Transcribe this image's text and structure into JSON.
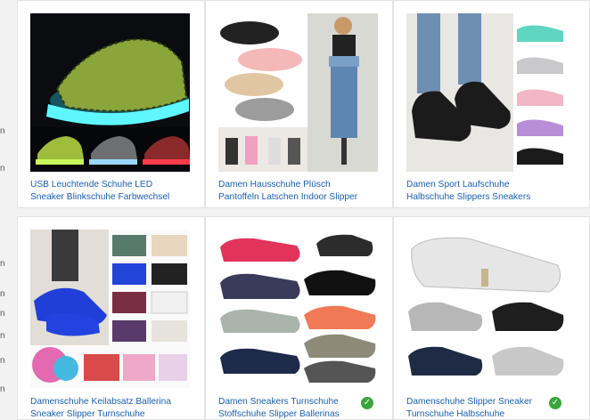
{
  "products": [
    {
      "line1": "USB Leuchtende Schuhe LED",
      "line2": "Sneaker Blinkschuhe Farbwechsel",
      "icon": "led-sneaker-image",
      "verified": false
    },
    {
      "line1": "Damen Hausschuhe Plüsch",
      "line2": "Pantoffeln Latschen Indoor Slipper",
      "icon": "slipper-image",
      "verified": false
    },
    {
      "line1": "Damen Sport Laufschuhe",
      "line2": "Halbschuhe Slippers Sneakers",
      "icon": "sock-sneaker-image",
      "verified": false
    },
    {
      "line1": "Damenschuhe Keilabsatz Ballerina",
      "line2": "Sneaker Slipper Turnschuhe",
      "icon": "ballerina-image",
      "verified": false
    },
    {
      "line1": "Damen Sneakers Turnschuhe",
      "line2": "Stoffschuhe Slipper Ballerinas",
      "icon": "slip-on-image",
      "verified": true
    },
    {
      "line1": "Damenschuhe Slipper Sneaker",
      "line2": "Turnschuhe Halbschuhe",
      "icon": "canvas-slipper-image",
      "verified": true
    }
  ],
  "left_strip": [
    "n",
    "n",
    "n",
    "n",
    "n",
    "n",
    "n",
    "n"
  ],
  "colors": {
    "link": "#1a5fb4",
    "verified": "#3aa53a",
    "background": "#f2f2f2"
  }
}
